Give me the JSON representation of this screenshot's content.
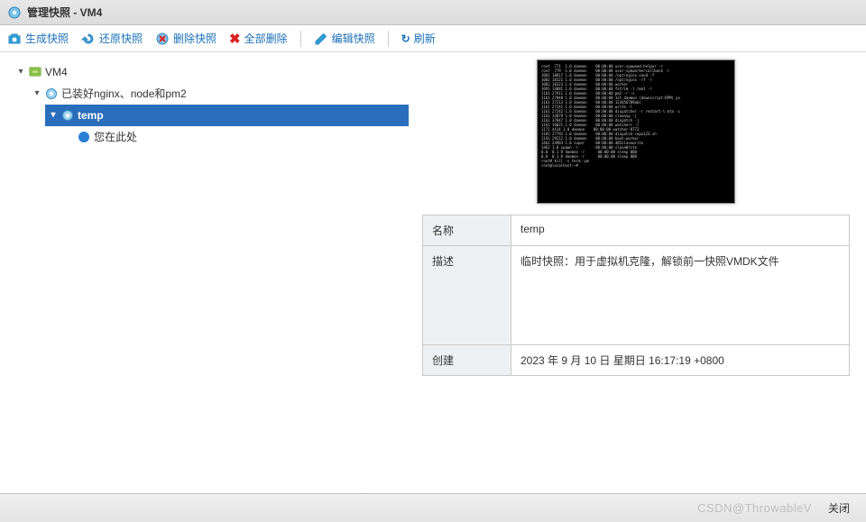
{
  "titlebar": {
    "text": "管理快照 - VM4"
  },
  "toolbar": {
    "take": "生成快照",
    "revert": "还原快照",
    "delete": "删除快照",
    "delete_all": "全部删除",
    "edit": "编辑快照",
    "refresh": "刷新"
  },
  "tree": {
    "root": {
      "label": "VM4"
    },
    "level1": {
      "label": "已装好nginx、node和pm2"
    },
    "level2": {
      "label": "temp"
    },
    "here": {
      "label": "您在此处"
    }
  },
  "details": {
    "name_label": "名称",
    "name_value": "temp",
    "desc_label": "描述",
    "desc_value": "临时快照：用于虚拟机克隆，解锁前一快照VMDK文件",
    "created_label": "创建",
    "created_value": "2023 年 9 月 10 日 星期日 16:17:19 +0800"
  },
  "footer": {
    "watermark": "CSDN@ThrowableV",
    "close": "关闭"
  },
  "terminal_stub": "root  771  1.0 daemon    00:00:00 user-spawned-helper -r\nroot  779  1.0 daemon    00:00:00 user-spkworkercallback -r\n1081 18817 1.0 daemon    00:00:00 /opt/nginx.cond -f\n1082 18321 1.0 daemon    00:00:00 /opt/nginx -rf -r\n1083 18323 1.0 daemon    00:00:00 worker\n1091 14081 1.0 daemon    00:00:00 fstrim -l /mnt -r\n1161 27911 1.0 daemon    00:00:00 pm2 -r -s\n1161 27948 1.0 daemon    00:00:00 1st daemon (downscript:RPM) ps\n1161 27213 1.0 daemon    00:00:00 123456789abc\n1161 27241 1.0 daemon    00:00:00 write -l\n1161 27242 1.0 daemon    00:00:00 dispatcher -r restart-l mta -c\n1161 33879 1.0 daemon    00:00:00 cleanup -j\n1161 37847 1.0 daemon    00:00:00 dispatch -j\n1161 16021 1.0 daemon    00:00:00 watcherr -r\n1171 4414 1.0 daemon    00:00:00 watcher-8772\n1181 27792 1.0 daemon    00:00:00 dispatch-repo123.sh\n1191 29212 1.0 daemon    00:00:00 bash-worker\n1461 24983 1.0 super     00:00:00 485slavewrite\n1462 1.0 spawn -r        00:00:00 slaveWrite\n0.0  0.1 R daemon -r      00:00:00 sleep 888\n0.0  0.1 R daemon -r      00:00:00 sleep 888\nroot# kill -s term -pm\nroot@localhost:~#"
}
